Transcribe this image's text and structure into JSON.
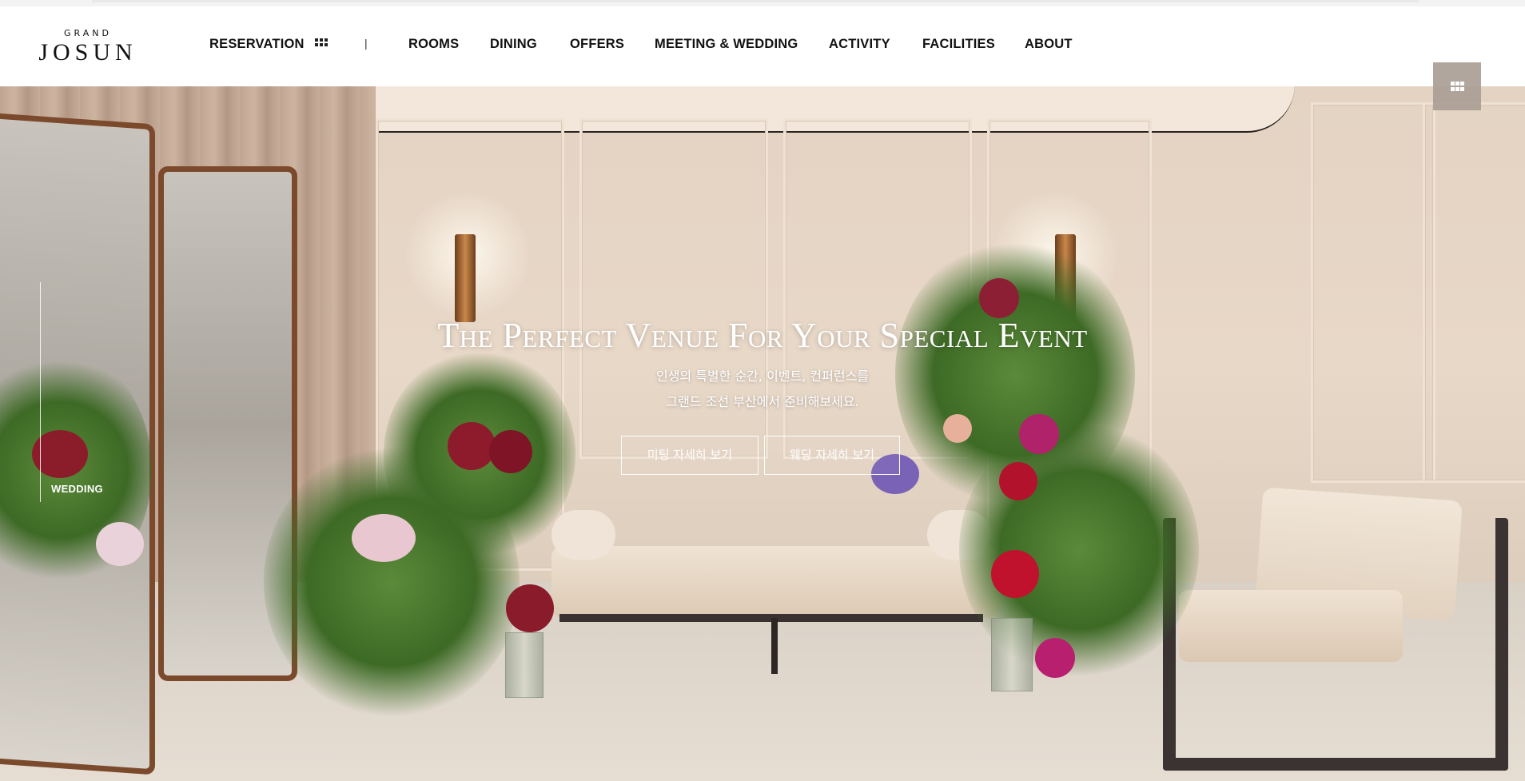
{
  "brand": {
    "logo_small": "GRAND",
    "logo_big": "JOSUN"
  },
  "nav": {
    "reservation": "RESERVATION",
    "separator": "|",
    "items": [
      "ROOMS",
      "DINING",
      "OFFERS",
      "MEETING & WEDDING",
      "ACTIVITY",
      "FACILITIES",
      "ABOUT"
    ]
  },
  "hero": {
    "title": "The Perfect Venue For Your Special Event",
    "subtitle_line1": "인생의 특별한 순간, 이벤트, 컨퍼런스를",
    "subtitle_line2": "그랜드 조선 부산에서 준비해보세요.",
    "button_meeting": "미팅 자세히 보기",
    "button_wedding": "웨딩 자세히 보기",
    "side_label": "WEDDING"
  },
  "icons": {
    "reservation_icon": "grid-icon",
    "menu_icon": "grid-menu-icon"
  },
  "colors": {
    "header_bg": "#ffffff",
    "nav_text": "#111111",
    "hero_text": "#ffffff",
    "menu_button_bg": "#aa9e96"
  }
}
